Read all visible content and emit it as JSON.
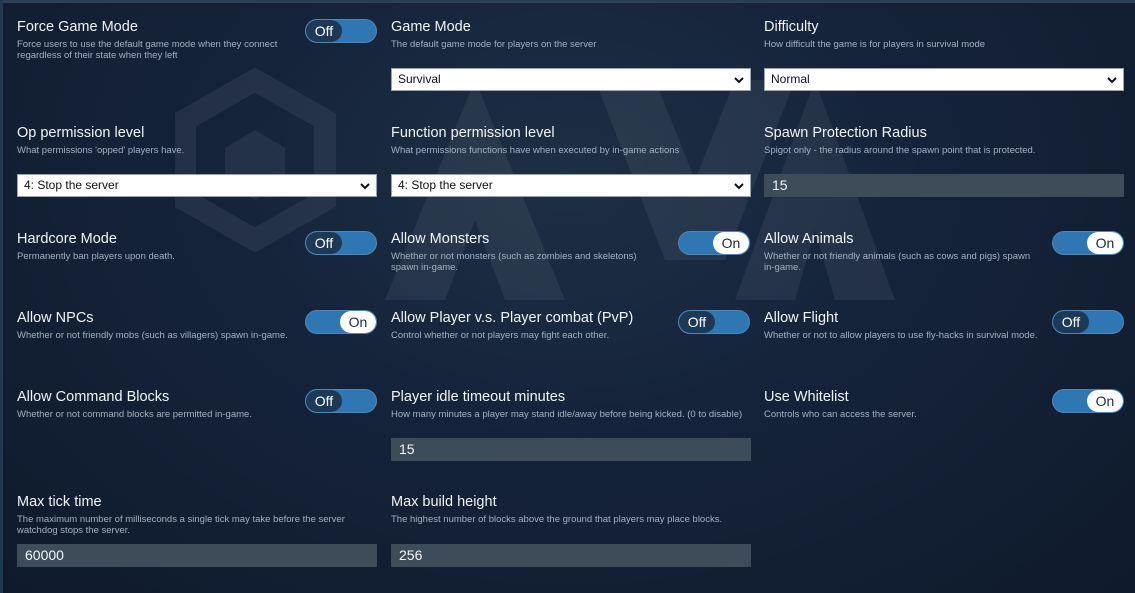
{
  "settings": {
    "force_game_mode": {
      "title": "Force Game Mode",
      "description": "Force users to use the default game mode when they connect regardless of their state when they left",
      "state": "Off"
    },
    "game_mode": {
      "title": "Game Mode",
      "description": "The default game mode for players on the server",
      "value": "Survival"
    },
    "difficulty": {
      "title": "Difficulty",
      "description": "How difficult the game is for players in survival mode",
      "value": "Normal"
    },
    "op_permission": {
      "title": "Op permission level",
      "description": "What permissions 'opped' players have.",
      "value": "4: Stop the server"
    },
    "function_permission": {
      "title": "Function permission level",
      "description": "What permissions functions have when executed by in-game actions",
      "value": "4: Stop the server"
    },
    "spawn_protection": {
      "title": "Spawn Protection Radius",
      "description": "Spigot only - the radius around the spawn point that is protected.",
      "value": "15"
    },
    "hardcore": {
      "title": "Hardcore Mode",
      "description": "Permanently ban players upon death.",
      "state": "Off"
    },
    "allow_monsters": {
      "title": "Allow Monsters",
      "description": "Whether or not monsters (such as zombies and skeletons) spawn in-game.",
      "state": "On"
    },
    "allow_animals": {
      "title": "Allow Animals",
      "description": "Whether or not friendly animals (such as cows and pigs) spawn in-game.",
      "state": "On"
    },
    "allow_npcs": {
      "title": "Allow NPCs",
      "description": "Whether or not friendly mobs (such as villagers) spawn in-game.",
      "state": "On"
    },
    "allow_pvp": {
      "title": "Allow Player v.s. Player combat (PvP)",
      "description": "Control whether or not players may fight each other.",
      "state": "Off"
    },
    "allow_flight": {
      "title": "Allow Flight",
      "description": "Whether or not to allow players to use fly-hacks in survival mode.",
      "state": "Off"
    },
    "allow_command_blocks": {
      "title": "Allow Command Blocks",
      "description": "Whether or not command blocks are permitted in-game.",
      "state": "Off"
    },
    "idle_timeout": {
      "title": "Player idle timeout minutes",
      "description": "How many minutes a player may stand idle/away before being kicked. (0 to disable)",
      "value": "15"
    },
    "use_whitelist": {
      "title": "Use Whitelist",
      "description": "Controls who can access the server.",
      "state": "On"
    },
    "max_tick_time": {
      "title": "Max tick time",
      "description": "The maximum number of milliseconds a single tick may take before the server watchdog stops the server.",
      "value": "60000"
    },
    "max_build_height": {
      "title": "Max build height",
      "description": "The highest number of blocks above the ground that players may place blocks.",
      "value": "256"
    }
  },
  "icons": {
    "watermark": "logo-watermark-icon",
    "select_arrow": "chevron-down-icon"
  },
  "colors": {
    "toggle_track": "#2f77b3",
    "toggle_off_knob": "#1e3956",
    "toggle_on_knob": "#ffffff",
    "input_bg": "#3e4c5a"
  }
}
